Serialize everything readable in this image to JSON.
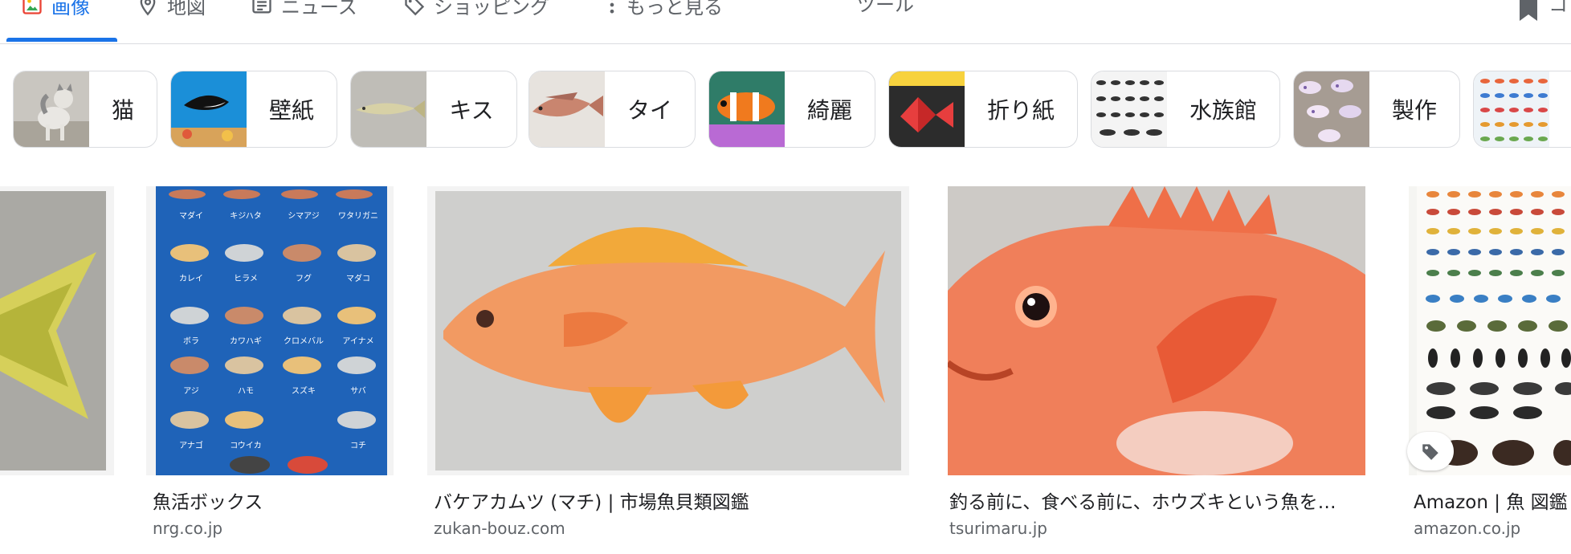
{
  "tabs": [
    {
      "label": "画像",
      "icon": "image-icon",
      "active": true
    },
    {
      "label": "地図",
      "icon": "map-pin-icon"
    },
    {
      "label": "ニュース",
      "icon": "news-icon"
    },
    {
      "label": "ショッピング",
      "icon": "tag-icon"
    },
    {
      "label": "もっと見る",
      "icon": "more-vert-icon"
    }
  ],
  "tools_label": "ツール",
  "save_label_fragment": "コ",
  "chips": [
    {
      "label": "猫",
      "thumb": "cat-thumbnail"
    },
    {
      "label": "壁紙",
      "thumb": "orca-wallpaper-thumbnail"
    },
    {
      "label": "キス",
      "thumb": "kisu-fish-thumbnail"
    },
    {
      "label": "タイ",
      "thumb": "tai-fish-thumbnail"
    },
    {
      "label": "綺麗",
      "thumb": "clownfish-thumbnail"
    },
    {
      "label": "折り紙",
      "thumb": "origami-fish-thumbnail"
    },
    {
      "label": "水族館",
      "thumb": "aquarium-chart-thumbnail"
    },
    {
      "label": "製作",
      "thumb": "fish-craft-thumbnail"
    },
    {
      "label": "",
      "thumb": "fish-chart-thumbnail"
    }
  ],
  "poster_labels": [
    [
      "マダイ",
      "キジハタ",
      "シマアジ",
      "ワタリガニ"
    ],
    [
      "カレイ",
      "ヒラメ",
      "フグ",
      "マダコ"
    ],
    [
      "ボラ",
      "カワハギ",
      "クロメバル",
      "アイナメ"
    ],
    [
      "アジ",
      "ハモ",
      "スズキ",
      "サバ"
    ],
    [
      "アナゴ",
      "コウイカ",
      "コチ"
    ]
  ],
  "results": [
    {
      "title": "",
      "source": ""
    },
    {
      "title": "魚活ボックス",
      "source": "nrg.co.jp"
    },
    {
      "title": "バケアカムツ (マチ) | 市場魚貝類図鑑",
      "source": "zukan-bouz.com"
    },
    {
      "title": "釣る前に、食べる前に、ホウズキという魚を…",
      "source": "tsurimaru.jp"
    },
    {
      "title": "Amazon | 魚 図鑑",
      "source": "amazon.co.jp"
    }
  ],
  "colors": {
    "accent": "#1a73e8",
    "poster_blue": "#1f63b8",
    "fish_orange": "#f08a52",
    "text_secondary": "#5f6368"
  }
}
